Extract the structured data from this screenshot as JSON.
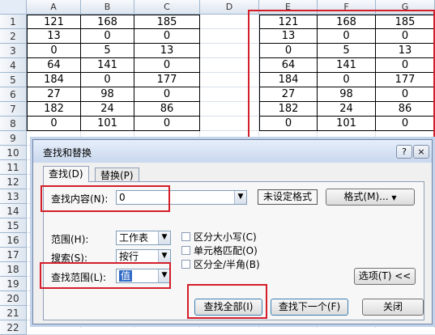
{
  "sheet": {
    "columns": [
      "A",
      "B",
      "C",
      "D",
      "E",
      "F",
      "G"
    ],
    "rows": [
      "1",
      "2",
      "3",
      "4",
      "5",
      "6",
      "7",
      "8",
      "9",
      "10",
      "11",
      "12",
      "13",
      "14",
      "15",
      "16",
      "17",
      "18",
      "19",
      "20",
      "21",
      "22"
    ],
    "left_table": [
      [
        "121",
        "168",
        "185"
      ],
      [
        "13",
        "0",
        "0"
      ],
      [
        "0",
        "5",
        "13"
      ],
      [
        "64",
        "141",
        "0"
      ],
      [
        "184",
        "0",
        "177"
      ],
      [
        "27",
        "98",
        "0"
      ],
      [
        "182",
        "24",
        "86"
      ],
      [
        "0",
        "101",
        "0"
      ]
    ],
    "right_table": [
      [
        "121",
        "168",
        "185"
      ],
      [
        "13",
        "0",
        "0"
      ],
      [
        "0",
        "5",
        "13"
      ],
      [
        "64",
        "141",
        "0"
      ],
      [
        "184",
        "0",
        "177"
      ],
      [
        "27",
        "98",
        "0"
      ],
      [
        "182",
        "24",
        "86"
      ],
      [
        "0",
        "101",
        "0"
      ]
    ]
  },
  "dialog": {
    "title": "查找和替换",
    "help_label": "?",
    "close_label": "×",
    "tabs": [
      {
        "label": "查找(D)"
      },
      {
        "label": "替换(P)"
      }
    ],
    "find_label": "查找内容(N):",
    "find_value": "0",
    "format_status": "未设定格式",
    "format_button": "格式(M)...",
    "within_label": "范围(H):",
    "within_value": "工作表",
    "search_label": "搜索(S):",
    "search_value": "按行",
    "lookin_label": "查找范围(L):",
    "lookin_value": "值",
    "options": [
      {
        "label": "区分大小写(C)"
      },
      {
        "label": "单元格匹配(O)"
      },
      {
        "label": "区分全/半角(B)"
      }
    ],
    "options_button": "选项(T) <<",
    "find_all_button": "查找全部(I)",
    "find_next_button": "查找下一个(F)",
    "close_button": "关闭"
  },
  "accent": {
    "highlight_red": "#d41e2a",
    "selection_blue": "#316ac5"
  }
}
